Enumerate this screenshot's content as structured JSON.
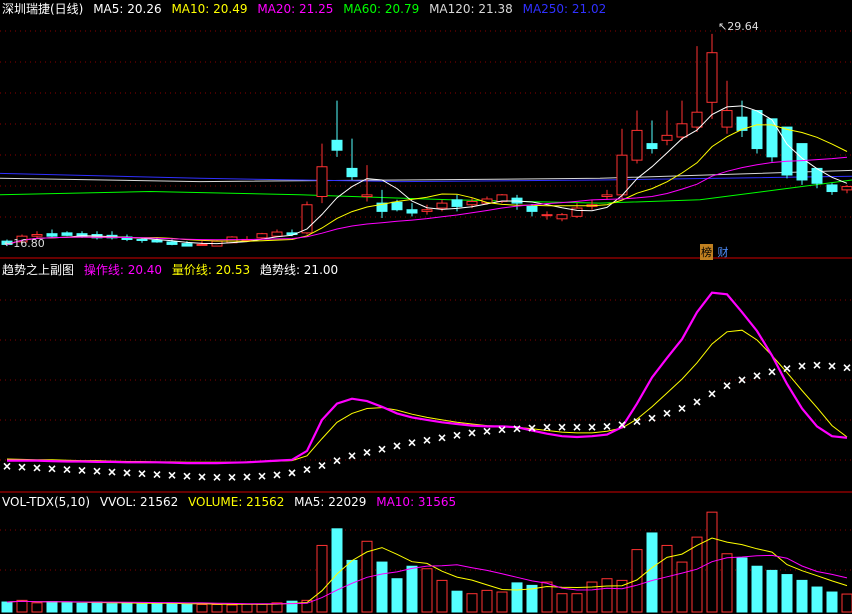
{
  "main_header": {
    "title": "深圳瑞捷(日线)",
    "ma5": "MA5: 20.26",
    "ma10": "MA10: 20.49",
    "ma20": "MA20: 21.25",
    "ma60": "MA60: 20.79",
    "ma120": "MA120: 21.38",
    "ma250": "MA250: 21.02"
  },
  "price_annotations": {
    "high": "29.64",
    "low": "16.80"
  },
  "badges": {
    "b1": "榜",
    "b2": "财"
  },
  "sub_header": {
    "title": "趋势之上副图",
    "op": "操作线: 20.40",
    "vol_price": "量价线: 20.53",
    "trend": "趋势线: 21.00"
  },
  "vol_header": {
    "title": "VOL-TDX(5,10)",
    "vvol": "VVOL: 21562",
    "volume": "VOLUME: 21562",
    "ma5": "MA5: 22029",
    "ma10": "MA10: 31565"
  },
  "colors": {
    "up": "#ff3232",
    "down": "#54ffff",
    "ma5": "#ffffff",
    "ma10": "#ffff00",
    "ma20": "#ff00ff",
    "ma60": "#00ff00",
    "ma120": "#d8d8d8",
    "ma250": "#3030ff",
    "grid": "#8a0000"
  },
  "chart_data": [
    {
      "type": "candlestick",
      "name": "price",
      "x": [
        0,
        1,
        2,
        3,
        4,
        5,
        6,
        7,
        8,
        9,
        10,
        11,
        12,
        13,
        14,
        15,
        16,
        17,
        18,
        19,
        20,
        21,
        22,
        23,
        24,
        25,
        26,
        27,
        28,
        29,
        30,
        31,
        32,
        33,
        34,
        35,
        36,
        37,
        38,
        39,
        40,
        41,
        42,
        43,
        44,
        45,
        46,
        47,
        48,
        49,
        50,
        51,
        52,
        53,
        54,
        55,
        56
      ],
      "open": [
        17.1,
        17.05,
        17.4,
        17.55,
        17.6,
        17.55,
        17.5,
        17.45,
        17.35,
        17.2,
        17.15,
        17.05,
        16.95,
        16.9,
        16.8,
        17.0,
        17.15,
        17.3,
        17.4,
        17.6,
        17.6,
        19.8,
        23.2,
        21.5,
        19.8,
        19.4,
        19.45,
        19.0,
        18.9,
        19.1,
        19.6,
        19.3,
        19.4,
        19.5,
        19.7,
        19.2,
        18.7,
        18.45,
        18.6,
        19.2,
        19.8,
        19.9,
        22.0,
        23.0,
        23.2,
        23.4,
        24.0,
        25.5,
        24.0,
        24.6,
        25.0,
        24.5,
        24.0,
        23.0,
        21.5,
        20.5,
        20.2
      ],
      "close": [
        16.9,
        17.4,
        17.5,
        17.4,
        17.45,
        17.4,
        17.3,
        17.3,
        17.2,
        17.15,
        17.05,
        16.9,
        16.8,
        16.9,
        17.1,
        17.35,
        17.2,
        17.55,
        17.65,
        17.5,
        19.3,
        21.6,
        22.6,
        21.0,
        19.9,
        18.9,
        19.0,
        18.8,
        19.0,
        19.4,
        19.2,
        19.5,
        19.65,
        19.9,
        19.4,
        18.9,
        18.7,
        18.7,
        19.1,
        19.3,
        19.9,
        22.3,
        23.8,
        22.7,
        23.5,
        24.2,
        24.9,
        28.5,
        25.0,
        23.8,
        22.7,
        22.2,
        21.1,
        20.8,
        20.6,
        20.1,
        20.4
      ],
      "high": [
        17.2,
        17.5,
        17.7,
        17.8,
        17.7,
        17.7,
        17.7,
        17.7,
        17.5,
        17.3,
        17.3,
        17.2,
        17.1,
        17.1,
        17.2,
        17.4,
        17.4,
        17.6,
        17.8,
        17.8,
        19.5,
        23.0,
        25.6,
        23.3,
        21.7,
        20.2,
        19.6,
        19.4,
        19.3,
        19.6,
        19.9,
        19.7,
        19.8,
        19.95,
        19.9,
        19.35,
        18.9,
        18.8,
        19.4,
        19.6,
        20.2,
        23.9,
        25.0,
        24.4,
        25.0,
        25.6,
        28.9,
        29.64,
        26.8,
        25.6,
        25.0,
        23.0,
        22.0,
        21.2,
        20.8,
        20.6,
        20.5
      ],
      "low": [
        16.8,
        17.0,
        17.3,
        17.3,
        17.4,
        17.3,
        17.2,
        17.2,
        17.1,
        17.0,
        17.0,
        16.85,
        16.8,
        16.85,
        16.8,
        17.0,
        17.1,
        17.2,
        17.35,
        17.4,
        17.5,
        19.4,
        22.2,
        20.8,
        19.5,
        18.5,
        18.9,
        18.6,
        18.7,
        18.9,
        18.9,
        19.1,
        19.3,
        19.4,
        19.0,
        18.6,
        18.4,
        18.3,
        18.5,
        19.0,
        19.6,
        19.7,
        21.8,
        22.4,
        22.9,
        23.2,
        23.7,
        24.5,
        23.6,
        23.4,
        22.4,
        21.9,
        20.9,
        20.5,
        20.3,
        19.9,
        20.0
      ],
      "ylim": [
        16.2,
        30.6
      ]
    },
    {
      "type": "line",
      "name": "trend-subchart",
      "series": [
        {
          "name": "操作线",
          "values": [
            17.6,
            17.6,
            17.6,
            17.55,
            17.5,
            17.5,
            17.45,
            17.45,
            17.4,
            17.4,
            17.4,
            17.35,
            17.3,
            17.3,
            17.3,
            17.35,
            17.4,
            17.5,
            17.6,
            17.7,
            18.8,
            22.6,
            24.6,
            25.2,
            24.9,
            24.2,
            23.4,
            22.9,
            22.6,
            22.3,
            22.1,
            21.9,
            21.8,
            21.8,
            21.7,
            21.3,
            20.9,
            20.6,
            20.5,
            20.6,
            20.8,
            21.7,
            24.6,
            27.8,
            30.2,
            32.5,
            35.8,
            38.2,
            38.0,
            35.8,
            33.5,
            30.5,
            27.0,
            24.0,
            21.8,
            20.6,
            20.4
          ]
        },
        {
          "name": "量价线",
          "values": [
            17.8,
            17.75,
            17.7,
            17.7,
            17.65,
            17.6,
            17.6,
            17.55,
            17.5,
            17.5,
            17.45,
            17.45,
            17.4,
            17.4,
            17.4,
            17.4,
            17.45,
            17.5,
            17.55,
            17.6,
            18.2,
            20.3,
            22.3,
            23.4,
            24.0,
            24.1,
            23.8,
            23.3,
            22.9,
            22.6,
            22.3,
            22.1,
            21.9,
            21.8,
            21.7,
            21.5,
            21.3,
            21.1,
            21.0,
            21.0,
            21.2,
            21.6,
            22.7,
            24.2,
            25.9,
            27.6,
            29.6,
            31.9,
            33.4,
            33.6,
            32.4,
            30.5,
            28.4,
            26.2,
            24.1,
            21.9,
            20.5
          ]
        },
        {
          "name": "趋势线",
          "values": [
            16.9,
            16.8,
            16.7,
            16.6,
            16.5,
            16.4,
            16.3,
            16.2,
            16.1,
            16.0,
            15.9,
            15.8,
            15.7,
            15.6,
            15.55,
            15.55,
            15.6,
            15.7,
            15.85,
            16.1,
            16.5,
            17.0,
            17.6,
            18.2,
            18.6,
            19.0,
            19.4,
            19.8,
            20.1,
            20.4,
            20.7,
            21.0,
            21.2,
            21.4,
            21.5,
            21.6,
            21.7,
            21.7,
            21.7,
            21.7,
            21.8,
            22.0,
            22.4,
            22.8,
            23.4,
            24.0,
            24.8,
            25.8,
            26.8,
            27.5,
            28.0,
            28.5,
            28.9,
            29.2,
            29.3,
            29.2,
            29.0
          ]
        }
      ],
      "ylim": [
        14.0,
        40.0
      ]
    },
    {
      "type": "bar",
      "name": "volume",
      "values": [
        12000,
        14000,
        11000,
        12500,
        11000,
        10500,
        12000,
        10000,
        11000,
        9500,
        10000,
        10500,
        9000,
        9000,
        9000,
        8500,
        9500,
        9500,
        11000,
        13000,
        14000,
        80000,
        100000,
        62000,
        85000,
        60000,
        40000,
        55000,
        52000,
        38000,
        25000,
        22000,
        26000,
        24000,
        35000,
        32000,
        36000,
        22000,
        22000,
        36000,
        40000,
        38000,
        75000,
        95000,
        80000,
        60000,
        90000,
        120000,
        70000,
        65000,
        55000,
        50000,
        45000,
        38000,
        30000,
        24000,
        21562
      ],
      "series": [
        {
          "name": "MA5",
          "values": [
            12000,
            13000,
            12300,
            12400,
            12100,
            11800,
            11400,
            11200,
            10900,
            10600,
            10600,
            10600,
            10000,
            9800,
            9500,
            9400,
            9400,
            9100,
            9500,
            10300,
            11400,
            25600,
            45700,
            61800,
            72200,
            77400,
            69400,
            60400,
            58400,
            49000,
            42000,
            38400,
            32600,
            27000,
            26400,
            27800,
            30600,
            29800,
            29400,
            30000,
            31200,
            31600,
            38600,
            53200,
            65600,
            69600,
            80000,
            89000,
            84000,
            81000,
            76000,
            72000,
            57000,
            49600,
            43600,
            37400,
            31700
          ]
        },
        {
          "name": "MA10",
          "values": [
            12000,
            13000,
            12300,
            12400,
            12200,
            12000,
            11900,
            11900,
            11700,
            11500,
            11300,
            11300,
            10900,
            10900,
            10500,
            10300,
            10000,
            9900,
            9900,
            10100,
            10500,
            17300,
            26300,
            34500,
            41700,
            45700,
            48200,
            52400,
            55200,
            55700,
            56700,
            53200,
            50000,
            45900,
            41700,
            37400,
            34500,
            28700,
            26500,
            26600,
            28500,
            28000,
            32200,
            37900,
            42300,
            46800,
            51400,
            60400,
            65200,
            66100,
            67600,
            68000,
            64700,
            55300,
            48700,
            45200,
            41000
          ]
        }
      ],
      "ylim": [
        0,
        125000
      ]
    }
  ]
}
